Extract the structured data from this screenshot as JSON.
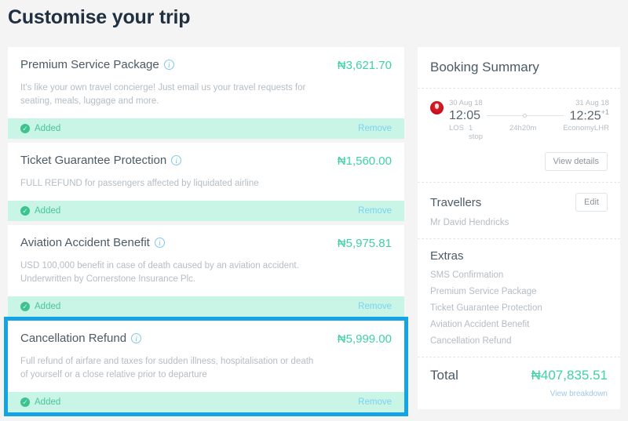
{
  "header": {
    "title": "Customise your trip"
  },
  "colors": {
    "accent_green": "#3fd0a8",
    "highlight_blue": "#14a3e5",
    "added_bg": "#c9f5e6",
    "link_blue": "#79d2f2"
  },
  "extras": [
    {
      "title": "Premium Service Package",
      "info_icon": "info-icon",
      "price": "₦3,621.70",
      "description": "It's like your own travel concierge! Just email us your travel requests for seating, meals, luggage and more.",
      "status_label": "Added",
      "status_icon": "check-circle-icon",
      "action_label": "Remove",
      "highlighted": false
    },
    {
      "title": "Ticket Guarantee Protection",
      "info_icon": "info-icon",
      "price": "₦1,560.00",
      "description": "FULL REFUND for passengers affected by liquidated airline",
      "status_label": "Added",
      "status_icon": "check-circle-icon",
      "action_label": "Remove",
      "highlighted": false
    },
    {
      "title": "Aviation Accident Benefit",
      "info_icon": "info-icon",
      "price": "₦5,975.81",
      "description": "USD 100,000 benefit in case of death caused by an aviation accident. Underwritten by Cornerstone Insurance Plc.",
      "status_label": "Added",
      "status_icon": "check-circle-icon",
      "action_label": "Remove",
      "highlighted": false
    },
    {
      "title": "Cancellation Refund",
      "info_icon": "info-icon",
      "price": "₦5,999.00",
      "description": "Full refund of airfare and taxes for sudden illness, hospitalisation or death of yourself or a close relative prior to departure",
      "status_label": "Added",
      "status_icon": "check-circle-icon",
      "action_label": "Remove",
      "highlighted": true
    }
  ],
  "summary": {
    "title": "Booking Summary",
    "flight": {
      "airline_logo": "airline-logo-icon",
      "depart_date": "30 Aug 18",
      "arrive_date": "31 Aug 18",
      "depart_time": "12:05",
      "arrive_time": "12:25",
      "arrive_day_offset": "+1",
      "origin": "LOS",
      "destination": "LHR",
      "stops": "1 stop",
      "duration": "24h20m",
      "cabin": "Economy",
      "view_details_label": "View details"
    },
    "travellers": {
      "title": "Travellers",
      "edit_label": "Edit",
      "names": [
        "Mr David Hendricks"
      ]
    },
    "extras_section": {
      "title": "Extras",
      "items": [
        "SMS Confirmation",
        "Premium Service Package",
        "Ticket Guarantee Protection",
        "Aviation Accident Benefit",
        "Cancellation Refund"
      ]
    },
    "total": {
      "label": "Total",
      "value": "₦407,835.51",
      "breakdown_label": "View breakdown"
    }
  }
}
